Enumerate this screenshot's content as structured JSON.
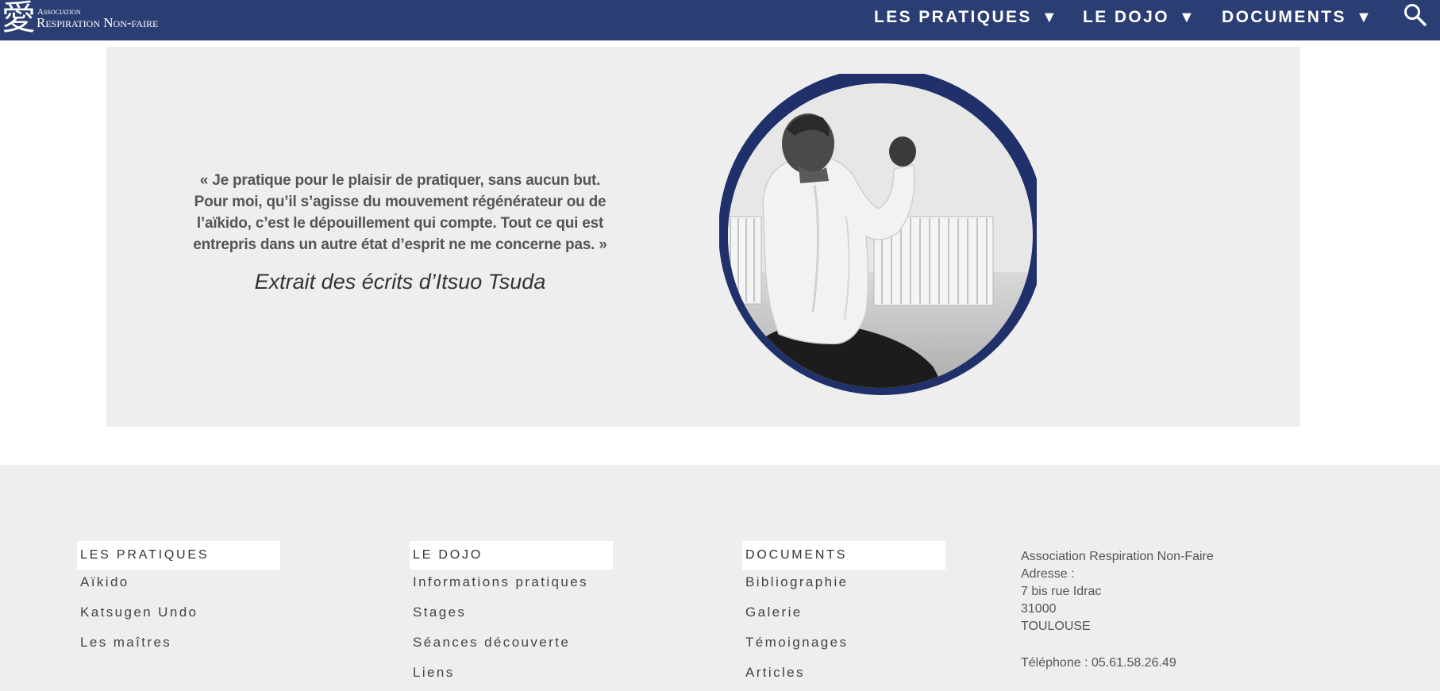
{
  "header": {
    "logo": {
      "kanji": "愛",
      "small_text": "Association",
      "main_text": "Respiration Non-faire"
    },
    "nav": [
      {
        "label": "LES PRATIQUES",
        "arrow": "▼"
      },
      {
        "label": "LE DOJO",
        "arrow": "▼"
      },
      {
        "label": "DOCUMENTS",
        "arrow": "▼"
      }
    ],
    "search_icon": "search-icon"
  },
  "quote": {
    "lines": [
      "« Je pratique pour le plaisir de pratiquer, sans aucun but.",
      "Pour moi, qu’il s’agisse du mouvement régénérateur ou de",
      "l’aïkido, c’est le dépouillement qui compte. Tout ce qui est",
      "entrepris dans un autre état d’esprit ne me concerne pas. »"
    ],
    "attribution": "Extrait des écrits d’Itsuo Tsuda"
  },
  "footer": {
    "columns": [
      {
        "heading": "LES PRATIQUES",
        "links": [
          "Aïkido",
          "Katsugen Undo",
          "Les maîtres"
        ]
      },
      {
        "heading": "LE DOJO",
        "links": [
          "Informations pratiques",
          "Stages",
          "Séances découverte",
          "Liens"
        ]
      },
      {
        "heading": "DOCUMENTS",
        "links": [
          "Bibliographie",
          "Galerie",
          "Témoignages",
          "Articles"
        ]
      }
    ],
    "contact": {
      "name": "Association Respiration Non-Faire",
      "address_label": "Adresse :",
      "street": "7 bis rue Idrac",
      "postcode": "31000",
      "city": "TOULOUSE",
      "phone": "Téléphone : 05.61.58.26.49"
    }
  },
  "colors": {
    "header_bg": "#2b3e74",
    "section_bg": "#eeeeee",
    "accent_navy": "#20306a"
  }
}
